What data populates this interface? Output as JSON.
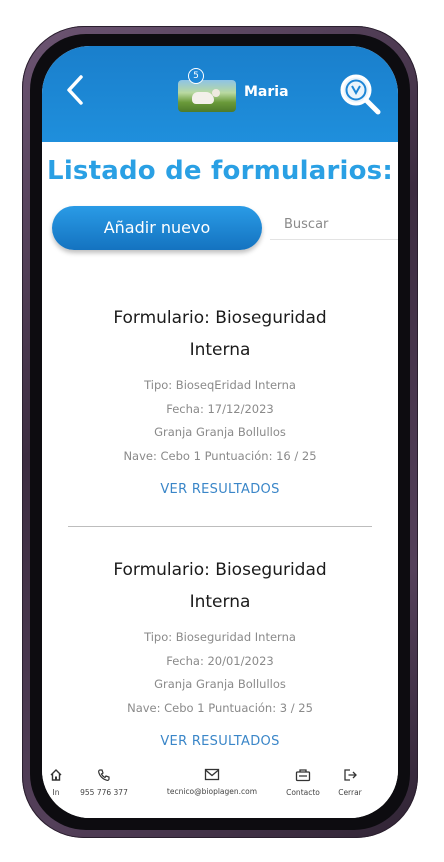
{
  "header": {
    "user_name": "Maria",
    "notification_count": "5"
  },
  "page_title": "Listado de formularios:",
  "add_button_label": "Añadir nuevo",
  "search": {
    "placeholder": "Buscar"
  },
  "forms": [
    {
      "title_line1": "Formulario: Bioseguridad",
      "title_line2": "Interna",
      "tipo": "Tipo: BioseqEridad Interna",
      "fecha": "Fecha: 17/12/2023",
      "granja": "Granja Granja Bollullos",
      "nave": "Nave: Cebo 1 Puntuación: 16 / 25",
      "results_label": "VER RESULTADOS"
    },
    {
      "title_line1": "Formulario: Bioseguridad",
      "title_line2": "Interna",
      "tipo": "Tipo: Bioseguridad Interna",
      "fecha": "Fecha: 20/01/2023",
      "granja": "Granja Granja Bollullos",
      "nave": "Nave: Cebo 1 Puntuación: 3 / 25",
      "results_label": "VER RESULTADOS"
    }
  ],
  "bottom_nav": [
    {
      "icon": "home-icon",
      "label": "In"
    },
    {
      "icon": "phone-icon",
      "label": "955 776 377"
    },
    {
      "icon": "mail-icon",
      "label": "tecnico@bioplagen.com"
    },
    {
      "icon": "contact-icon",
      "label": "Contacto"
    },
    {
      "icon": "logout-icon",
      "label": "Cerrar"
    }
  ],
  "colors": {
    "header": "#1f8fdc",
    "accent": "#2aa0e4",
    "link": "#3a86c8",
    "frame": "#54405a"
  }
}
